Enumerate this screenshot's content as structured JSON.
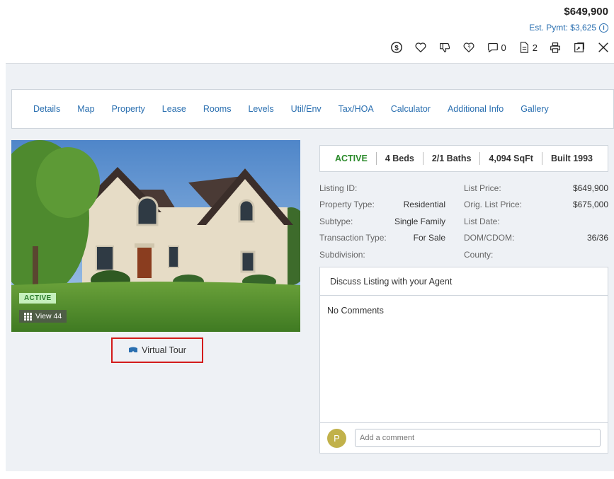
{
  "header": {
    "price": "$649,900",
    "est_payment": "Est. Pymt: $3,625",
    "toolbar": {
      "comments_count": "0",
      "docs_count": "2"
    }
  },
  "tabs": [
    "Details",
    "Map",
    "Property",
    "Lease",
    "Rooms",
    "Levels",
    "Util/Env",
    "Tax/HOA",
    "Calculator",
    "Additional Info",
    "Gallery"
  ],
  "photo": {
    "status_badge": "ACTIVE",
    "view_label": "View 44"
  },
  "virtual_tour_label": "Virtual Tour",
  "status_bar": {
    "status": "ACTIVE",
    "beds": "4 Beds",
    "baths": "2/1 Baths",
    "sqft": "4,094 SqFt",
    "built": "Built 1993"
  },
  "facts": {
    "left": [
      {
        "label": "Listing ID:",
        "value": ""
      },
      {
        "label": "Property Type:",
        "value": "Residential"
      },
      {
        "label": "Subtype:",
        "value": "Single Family"
      },
      {
        "label": "Transaction Type:",
        "value": "For Sale"
      },
      {
        "label": "Subdivision:",
        "value": ""
      }
    ],
    "right": [
      {
        "label": "List Price:",
        "value": "$649,900"
      },
      {
        "label": "Orig. List Price:",
        "value": "$675,000"
      },
      {
        "label": "List Date:",
        "value": ""
      },
      {
        "label": "DOM/CDOM:",
        "value": "36/36"
      },
      {
        "label": "County:",
        "value": ""
      }
    ]
  },
  "discuss": {
    "title": "Discuss Listing with your Agent",
    "empty_text": "No Comments",
    "avatar_initial": "P",
    "comment_placeholder": "Add a comment"
  },
  "colors": {
    "link": "#2a6fb0",
    "active_green": "#2b8a2b",
    "highlight_red": "#d31b1b",
    "avatar": "#c1b14a"
  }
}
